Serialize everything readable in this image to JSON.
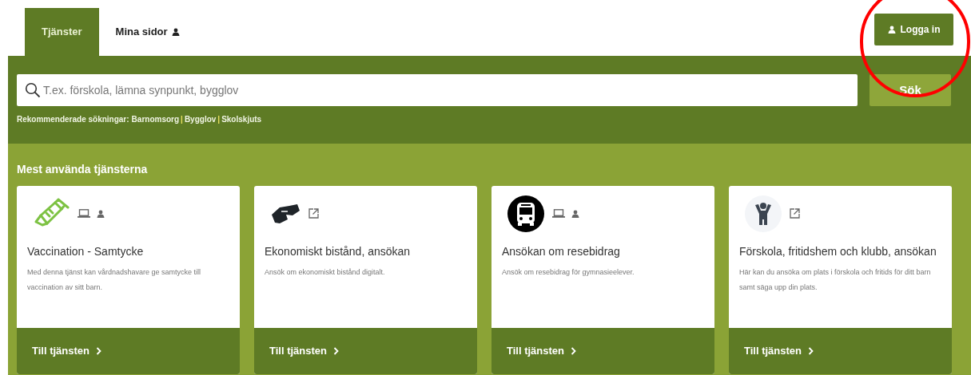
{
  "tabs": [
    {
      "label": "Tjänster",
      "selected": true,
      "kind": "plain"
    },
    {
      "label": "Mina sidor",
      "selected": false,
      "kind": "account"
    }
  ],
  "login_button": {
    "label": "Logga in"
  },
  "search": {
    "placeholder": "T.ex. förskola, lämna synpunkt, bygglov",
    "button": "Sök"
  },
  "recommended": {
    "label": "Rekommenderade sökningar:",
    "links": [
      "Barnomsorg",
      "Bygglov",
      "Skolskjuts"
    ],
    "separators": [
      "|",
      "|"
    ]
  },
  "section_title": "Mest använda tjänsterna",
  "cards": [
    {
      "kind": "syringe",
      "badges": [
        {
          "kind": "laptop"
        },
        {
          "kind": "person"
        }
      ],
      "title": "Vaccination - Samtycke",
      "description": "Med denna tjänst kan vårdnadshavare ge samtycke till vaccination av sitt barn.",
      "link": "Till tjänsten"
    },
    {
      "kind": "handshake",
      "badges": [
        {
          "kind": "external"
        }
      ],
      "title": "Ekonomiskt bistånd, ansökan",
      "description": "Ansök om ekonomiskt bistånd digitalt.",
      "link": "Till tjänsten"
    },
    {
      "kind": "bus",
      "badges": [
        {
          "kind": "laptop"
        },
        {
          "kind": "person"
        }
      ],
      "title": "Ansökan om resebidrag",
      "description": "Ansök om resebidrag för gymnasieelever.",
      "link": "Till tjänsten"
    },
    {
      "kind": "child",
      "badges": [
        {
          "kind": "external"
        }
      ],
      "title": "Förskola, fritidshem och klubb, ansökan",
      "description": "Här kan du ansöka om plats i  förskola och fritids för ditt barn samt säga upp din plats.",
      "link": "Till tjänsten"
    }
  ],
  "annotation": {
    "kind": "circle"
  }
}
